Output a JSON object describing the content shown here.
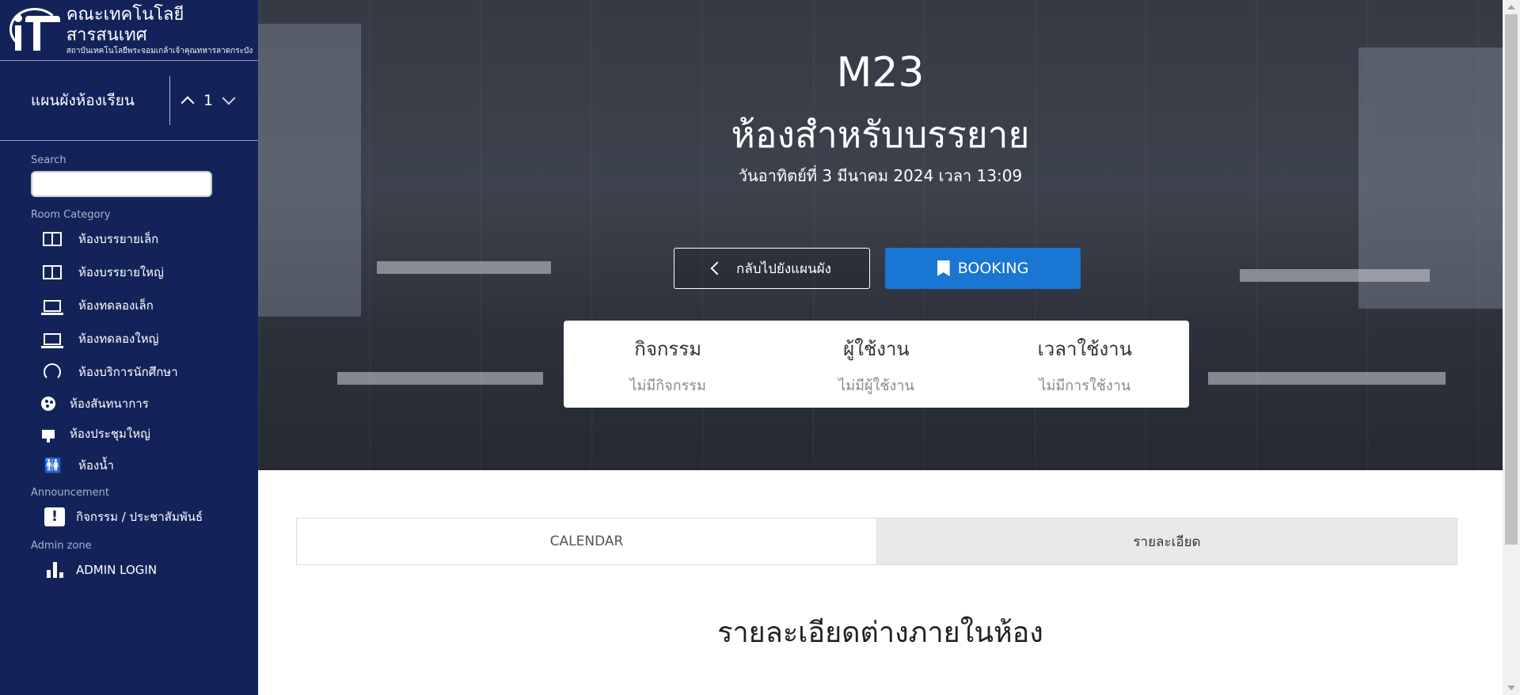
{
  "sidebar": {
    "logo": {
      "title": "คณะเทคโนโลยีสารสนเทศ",
      "subtitle": "สถาบันเทคโนโลยีพระจอมเกล้าเจ้าคุณทหารลาดกระบัง"
    },
    "floor": {
      "label": "แผนผังห้องเรียน",
      "value": "1"
    },
    "search_label": "Search",
    "search_value": "",
    "category_label": "Room Category",
    "categories": [
      {
        "label": "ห้องบรรยายเล็ก",
        "icon": "book-open-icon"
      },
      {
        "label": "ห้องบรรยายใหญ่",
        "icon": "book-open-icon"
      },
      {
        "label": "ห้องทดลองเล็ก",
        "icon": "laptop-icon"
      },
      {
        "label": "ห้องทดลองใหญ่",
        "icon": "laptop-icon"
      },
      {
        "label": "ห้องบริการนักศึกษา",
        "icon": "support-icon"
      },
      {
        "label": "ห้องสันทนาการ",
        "icon": "palette-icon"
      },
      {
        "label": "ห้องประชุมใหญ่",
        "icon": "presentation-icon"
      },
      {
        "label": "ห้องน้ำ",
        "icon": "restroom-icon"
      }
    ],
    "announcement_label": "Announcement",
    "announcement_item": "กิจกรรม / ประชาสัมพันธ์",
    "admin_label": "Admin zone",
    "admin_item": "ADMIN LOGIN"
  },
  "hero": {
    "room_code": "M23",
    "room_name": "ห้องสำหรับบรรยาย",
    "datetime": "วันอาทิตย์ที่ 3 มีนาคม 2024 เวลา 13:09",
    "back_button": "กลับไปยังแผนผัง",
    "booking_button": "BOOKING",
    "stats": [
      {
        "title": "กิจกรรม",
        "value": "ไม่มีกิจกรรม"
      },
      {
        "title": "ผู้ใช้งาน",
        "value": "ไม่มีผู้ใช้งาน"
      },
      {
        "title": "เวลาใช้งาน",
        "value": "ไม่มีการใช้งาน"
      }
    ]
  },
  "tabs": [
    {
      "label": "CALENDAR",
      "active": false
    },
    {
      "label": "รายละเอียด",
      "active": true
    }
  ],
  "details_title": "รายละเอียดต่างภายในห้อง",
  "colors": {
    "sidebar": "#13235a",
    "booking": "#1976d2"
  }
}
